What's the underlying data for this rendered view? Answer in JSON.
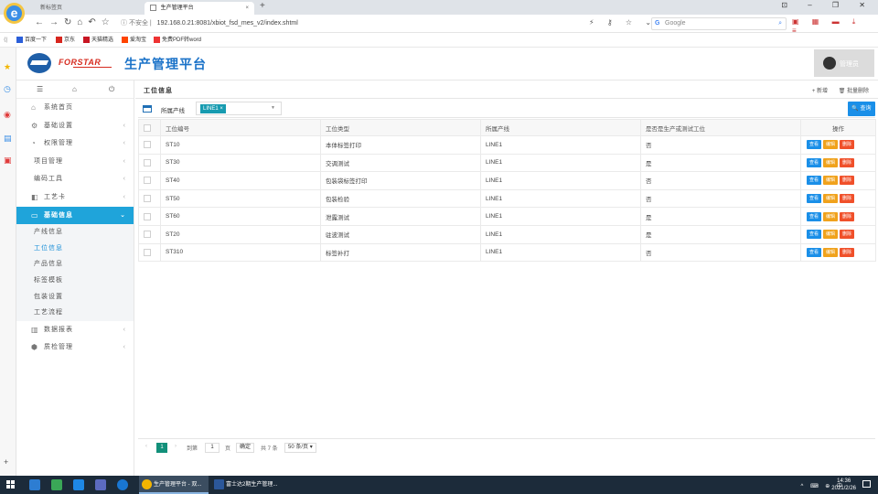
{
  "browser": {
    "tabs": [
      {
        "label": "新标签页",
        "close": "×"
      },
      {
        "label": "生产管理平台",
        "close": "×"
      }
    ],
    "new_tab": "+",
    "security_label": "不安全",
    "url": "192.168.0.21:8081/xbiot_fsd_mes_v2/index.shtml",
    "search_placeholder": "Google",
    "bookmarks": [
      {
        "label": "百度一下",
        "color": "#2b5fd9"
      },
      {
        "label": "京东",
        "color": "#d7261e"
      },
      {
        "label": "天猫精选",
        "color": "#c81623"
      },
      {
        "label": "爱淘宝",
        "color": "#ff4400"
      },
      {
        "label": "免费PDF转word",
        "color": "#e33"
      }
    ]
  },
  "app": {
    "brand": "FORSTAR",
    "title": "生产管理平台",
    "user_name": "管理员"
  },
  "sidebar": {
    "items": [
      {
        "label": "系统首页",
        "icon": "home-icon",
        "glyph": "⌂",
        "arrow": ""
      },
      {
        "label": "基础设置",
        "icon": "gear-icon",
        "glyph": "⚙",
        "arrow": "‹"
      },
      {
        "label": "权限管理",
        "icon": "shield-icon",
        "glyph": "◔",
        "arrow": "‹"
      },
      {
        "label": "项目管理",
        "icon": "",
        "glyph": "",
        "arrow": "‹"
      },
      {
        "label": "编码工具",
        "icon": "",
        "glyph": "",
        "arrow": "‹"
      },
      {
        "label": "工艺卡",
        "icon": "card-icon",
        "glyph": "◧",
        "arrow": "‹"
      }
    ],
    "active": {
      "label": "基础信息",
      "icon": "monitor-icon",
      "glyph": "▭",
      "arrow": "⌄"
    },
    "sub_items": [
      "产线信息",
      "工位信息",
      "产品信息",
      "标签模板",
      "包装设置",
      "工艺流程"
    ],
    "bottom_items": [
      {
        "label": "数据报表",
        "icon": "report-icon",
        "glyph": "▥",
        "arrow": "‹"
      },
      {
        "label": "质检管理",
        "icon": "cube-icon",
        "glyph": "⬢",
        "arrow": "‹"
      }
    ]
  },
  "panel": {
    "title": "工位信息",
    "add_label": "+ 新增",
    "batch_delete_label": "🗑 批量删除"
  },
  "filter": {
    "label": "所属产线",
    "chip": "LINE1",
    "chip_close": "×",
    "query_label": "🔍 查询"
  },
  "table": {
    "columns": [
      "工位编号",
      "工位类型",
      "所属产线",
      "是否是生产或测试工位",
      "操作"
    ],
    "rows": [
      [
        "ST10",
        "本体标签打印",
        "LINE1",
        "否"
      ],
      [
        "ST30",
        "交调测试",
        "LINE1",
        "是"
      ],
      [
        "ST40",
        "包装袋标签打印",
        "LINE1",
        "否"
      ],
      [
        "ST50",
        "包装检验",
        "LINE1",
        "否"
      ],
      [
        "ST60",
        "泄露测试",
        "LINE1",
        "是"
      ],
      [
        "ST20",
        "驻波测试",
        "LINE1",
        "是"
      ],
      [
        "ST310",
        "标签补打",
        "LINE1",
        "否"
      ]
    ],
    "actions": {
      "view": "查看",
      "edit": "编辑",
      "delete": "删除"
    }
  },
  "pager": {
    "prev": "‹",
    "current": "1",
    "next": "›",
    "goto_label": "到第",
    "goto_value": "1",
    "page_unit": "页",
    "confirm_label": "确定",
    "total_label": "共 7 条",
    "page_size": "50 条/页"
  },
  "taskbar": {
    "apps": [
      "生产管理平台 - 双...",
      "富士达2期生产管理..."
    ],
    "tray": "^ ⌨ ⊕ 中",
    "time": "14:36",
    "date": "2021/2/26"
  }
}
